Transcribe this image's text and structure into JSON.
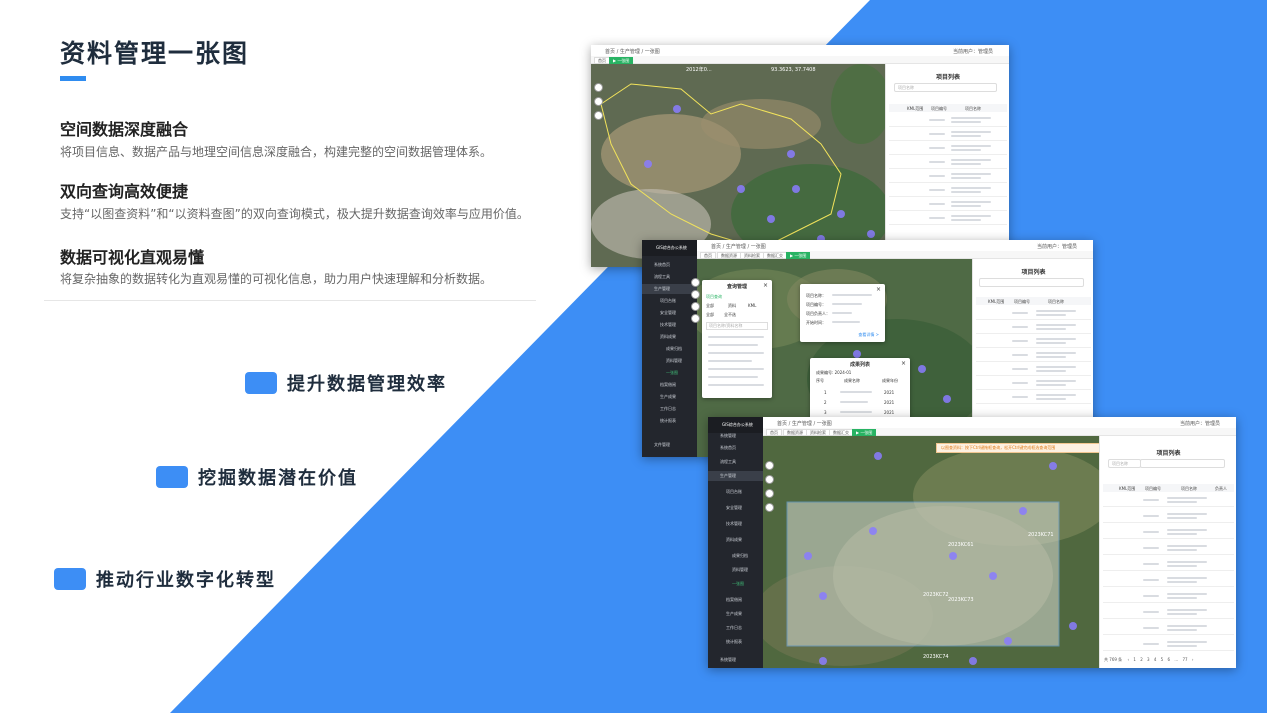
{
  "page": {
    "title": "资料管理一张图",
    "features": [
      {
        "heading": "空间数据深度融合",
        "desc": "将项目信息、数据产品与地理空间信息深度融合，构建完整的空间数据管理体系。"
      },
      {
        "heading": "双向查询高效便捷",
        "desc": "支持“以图查资料”和“以资料查图”的双向查询模式，极大提升数据查询效率与应用价值。"
      },
      {
        "heading": "数据可视化直观易懂",
        "desc": "将复杂抽象的数据转化为直观易懂的可视化信息，助力用户快速理解和分析数据。"
      }
    ],
    "bullets": [
      "提升数据管理效率",
      "挖掘数据潜在价值",
      "推动行业数字化转型"
    ]
  },
  "colors": {
    "accent": "#2f8cf0",
    "bg_blue": "#3d8ef5",
    "sidebar": "#23262d",
    "green": "#28b363"
  },
  "shot1": {
    "crumbs": "首页 / 生产管理 / 一张图",
    "user": "当前用户：管理员",
    "tabs": [
      "首页",
      "▶ 一张图"
    ],
    "panel_title": "项目列表",
    "search_placeholder": "项目名称",
    "columns": [
      "KML范围",
      "项目编号",
      "项目名称"
    ],
    "map_label_1": "2012年0...",
    "map_label_2": "93.3623, 37.7408"
  },
  "shot2": {
    "crumbs": "首页 / 生产管理 / 一张图",
    "user": "当前用户：管理员",
    "tabs": [
      "首页",
      "数据资源",
      "资料检索",
      "数据汇交",
      "▶ 一张图"
    ],
    "logo": "GIS综合办公系统",
    "menu": [
      "系统首页",
      "流程工具",
      "生产管理",
      "项目台账",
      "安全管理",
      "技术管理",
      "资料成果",
      "成果归档",
      "资料管理",
      "一张图",
      "档案借阅",
      "生产成果",
      "工作日志",
      "统计报表",
      "文件管理"
    ],
    "panel_title": "项目列表",
    "columns": [
      "KML范围",
      "项目编号",
      "项目名称"
    ],
    "dialog_query_title": "查询管理",
    "dialog_query_items": [
      "项目查询",
      "全部",
      "资料",
      "KML",
      "全部",
      "全不选"
    ],
    "dialog_query_search": "项目名称/资料名称",
    "dialog_info_fields": [
      "项目名称：",
      "项目编号：",
      "项目负责人：",
      "开始时间："
    ],
    "dialog_info_link": "查看详情 >",
    "dialog_result_title": "成果列表",
    "dialog_result_sub": "成果编号: 2024-01",
    "dialog_result_cols": [
      "序号",
      "成果名称",
      "成果年份"
    ],
    "dialog_result_rows": [
      [
        "1",
        "2021"
      ],
      [
        "2",
        "2021"
      ],
      [
        "3",
        "2021"
      ]
    ]
  },
  "shot3": {
    "crumbs": "首页 / 生产管理 / 一张图",
    "user": "当前用户：管理员",
    "tabs": [
      "首页",
      "数据资源",
      "资料检索",
      "数据汇交",
      "▶ 一张图"
    ],
    "logo": "GIS综合办公系统",
    "menu": [
      "系统管理",
      "系统首页",
      "流程工具",
      "生产管理",
      "项目台账",
      "安全管理",
      "技术管理",
      "资料成果",
      "成果归档",
      "资料管理",
      "一张图",
      "档案借阅",
      "生产成果",
      "工作日志",
      "统计报表",
      "系统管理"
    ],
    "notice": "以图查资料：按下Ctrl键拖框查询，松开Ctrl键完成框选查询范围",
    "panel_title": "项目列表",
    "panel_filter": "项目名称",
    "columns": [
      "KML范围",
      "项目编号",
      "项目名称",
      "负责人"
    ],
    "pager": [
      "共 769 条",
      "‹",
      "1",
      "2",
      "3",
      "4",
      "5",
      "6",
      "...",
      "77",
      "›"
    ],
    "map_labels": [
      "2023KC61",
      "2023KC71",
      "2023KC72",
      "2023KC73",
      "2023KC74"
    ]
  }
}
